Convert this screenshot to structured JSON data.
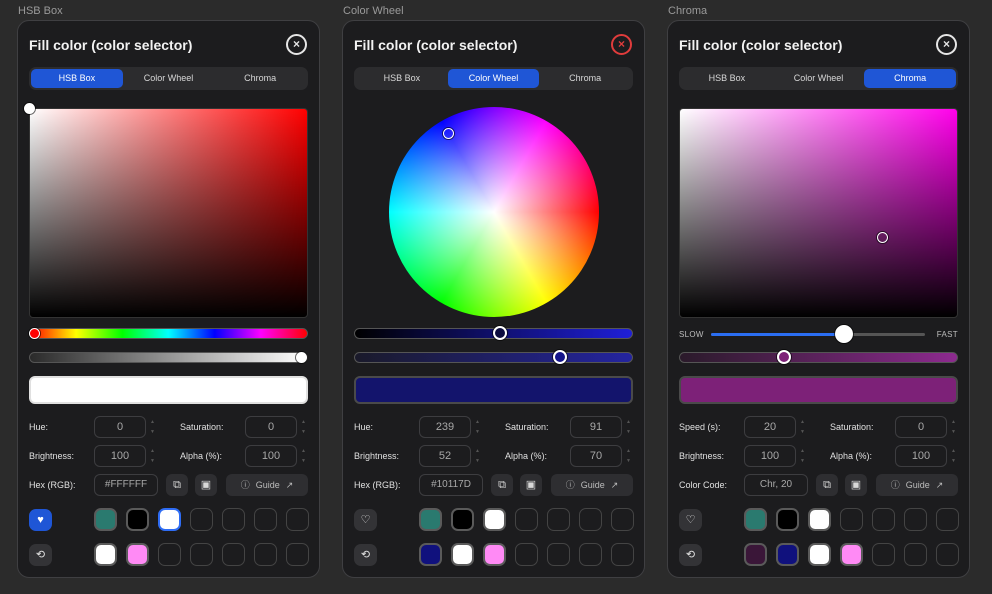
{
  "frames": [
    {
      "frame_label": "HSB Box",
      "title": "Fill color (color selector)",
      "close_icon": "×",
      "tabs": [
        "HSB Box",
        "Color Wheel",
        "Chroma"
      ],
      "active_tab": 0,
      "fields": {
        "hue_label": "Hue:",
        "hue": "0",
        "saturation_label": "Saturation:",
        "saturation": "0",
        "brightness_label": "Brightness:",
        "brightness": "100",
        "alpha_label": "Alpha (%):",
        "alpha": "100",
        "hex_label": "Hex (RGB):",
        "hex": "#FFFFFF"
      },
      "guide_label": "Guide",
      "preview_color": "#ffffff",
      "favorites": [
        "#2a7a6f",
        "#000000",
        "#ffffff",
        null,
        null,
        null,
        null
      ],
      "recent": [
        "#ffffff",
        "#ff8af5",
        null,
        null,
        null,
        null,
        null
      ]
    },
    {
      "frame_label": "Color Wheel",
      "title": "Fill color (color selector)",
      "close_icon": "×",
      "tabs": [
        "HSB Box",
        "Color Wheel",
        "Chroma"
      ],
      "active_tab": 1,
      "fields": {
        "hue_label": "Hue:",
        "hue": "239",
        "saturation_label": "Saturation:",
        "saturation": "91",
        "brightness_label": "Brightness:",
        "brightness": "52",
        "alpha_label": "Alpha (%):",
        "alpha": "70",
        "hex_label": "Hex (RGB):",
        "hex": "#10117D"
      },
      "guide_label": "Guide",
      "preview_color": "#13146c",
      "favorites": [
        "#2a7a6f",
        "#000000",
        "#ffffff",
        null,
        null,
        null,
        null
      ],
      "recent": [
        "#10117d",
        "#ffffff",
        "#ff8af5",
        null,
        null,
        null,
        null
      ]
    },
    {
      "frame_label": "Chroma",
      "title": "Fill color (color selector)",
      "close_icon": "×",
      "tabs": [
        "HSB Box",
        "Color Wheel",
        "Chroma"
      ],
      "active_tab": 2,
      "speed_slow": "SLOW",
      "speed_fast": "FAST",
      "speed_level": 0.62,
      "fields": {
        "hue_label": "Speed (s):",
        "hue": "20",
        "saturation_label": "Saturation:",
        "saturation": "0",
        "brightness_label": "Brightness:",
        "brightness": "100",
        "alpha_label": "Alpha (%):",
        "alpha": "100",
        "hex_label": "Color Code:",
        "hex": "Chr, 20"
      },
      "guide_label": "Guide",
      "preview_color": "#7d2178",
      "favorites": [
        "#2a7a6f",
        "#000000",
        "#ffffff",
        null,
        null,
        null,
        null
      ],
      "recent": [
        "#3a1638",
        "#10117d",
        "#ffffff",
        "#ff8af5",
        null,
        null,
        null
      ]
    }
  ],
  "icons": {
    "favorite": "heart-icon",
    "history": "history-icon",
    "copy": "copy-icon",
    "paste": "clipboard-icon",
    "help": "help-circle-icon",
    "external": "external-link-icon"
  }
}
